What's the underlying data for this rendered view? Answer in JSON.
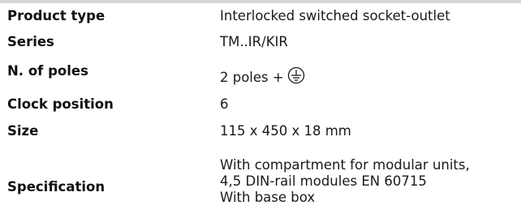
{
  "spec": {
    "product_type": {
      "label": "Product type",
      "value": "Interlocked switched socket-outlet"
    },
    "series": {
      "label": "Series",
      "value": "TM..IR/KIR"
    },
    "poles": {
      "label": "N. of poles",
      "value": "2 poles +",
      "icon": "earth-ground-icon"
    },
    "clock_position": {
      "label": "Clock position",
      "value": "6"
    },
    "size": {
      "label": "Size",
      "value": "115 x 450 x 18 mm"
    },
    "specification": {
      "label": "Specification",
      "lines": [
        "With compartment for modular units,",
        "4,5 DIN-rail modules EN 60715",
        "With base box"
      ]
    }
  }
}
